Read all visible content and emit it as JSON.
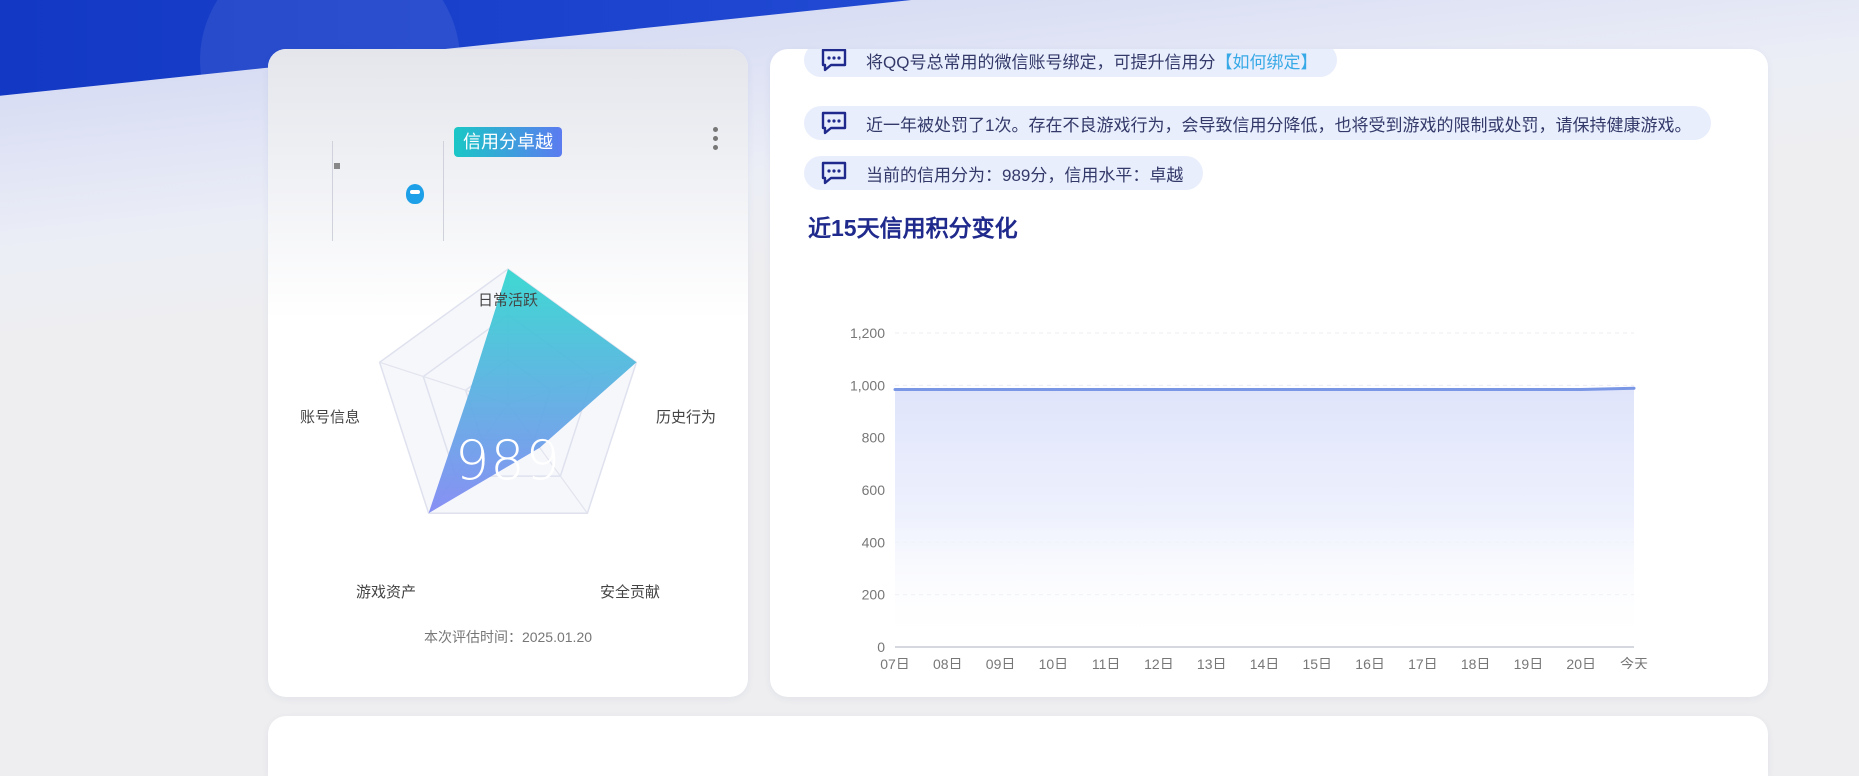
{
  "profile": {
    "level_badge": "信用分卓越",
    "eval_time": "本次评估时间：2025.01.20",
    "icons": {
      "more": "more-vertical-icon",
      "qq": "qq-penguin-icon"
    }
  },
  "radar": {
    "score": "989",
    "axes": [
      "日常活跃",
      "历史行为",
      "安全贡献",
      "游戏资产",
      "账号信息"
    ],
    "values": [
      1.0,
      1.0,
      0.4,
      1.0,
      0.3
    ],
    "colors": {
      "fill_top": "#2fd6cf",
      "fill_bottom": "#7f87f3",
      "grid": "#dfe2ee"
    }
  },
  "tips": [
    {
      "text": "将QQ号总常用的微信账号绑定，可提升信用分",
      "link": "【如何绑定】"
    },
    {
      "text": "近一年被处罚了1次。存在不良游戏行为，会导致信用分降低，也将受到游戏的限制或处罚，请保持健康游戏。"
    },
    {
      "text": "当前的信用分为：989分，信用水平：卓越"
    }
  ],
  "chart_title": "近15天信用积分变化",
  "chart_data": {
    "type": "area",
    "title": "近15天信用积分变化",
    "categories": [
      "07日",
      "08日",
      "09日",
      "10日",
      "11日",
      "12日",
      "13日",
      "14日",
      "15日",
      "16日",
      "17日",
      "18日",
      "19日",
      "20日",
      "今天"
    ],
    "values": [
      984,
      984,
      984,
      984,
      984,
      984,
      984,
      984,
      984,
      984,
      984,
      984,
      984,
      984,
      989
    ],
    "ylim": [
      0,
      1200
    ],
    "yticks": [
      "0",
      "200",
      "400",
      "600",
      "800",
      "1,000",
      "1,200"
    ],
    "grid": "horizontal dashed",
    "color": "#7a97e6"
  }
}
